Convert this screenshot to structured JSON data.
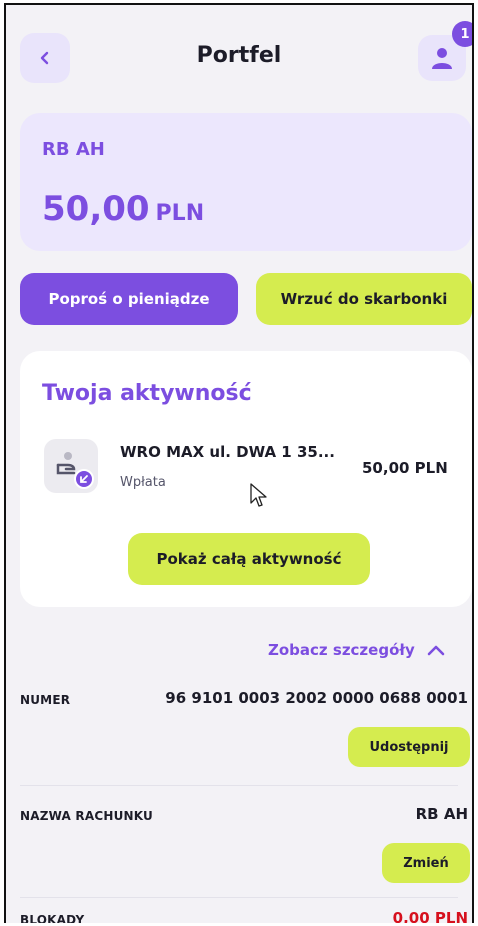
{
  "header": {
    "title": "Portfel",
    "notification_count": "1"
  },
  "account": {
    "name": "RB AH",
    "balance": "50,00",
    "currency": "PLN"
  },
  "actions": {
    "request_money": "Poproś o pieniądze",
    "deposit_piggy": "Wrzuć do skarbonki"
  },
  "activity": {
    "title": "Twoja aktywność",
    "items": [
      {
        "description": "WRO MAX ul. DWA 1 35...",
        "type": "Wpłata",
        "amount": "50,00 PLN"
      }
    ],
    "show_all": "Pokaż całą aktywność"
  },
  "details": {
    "toggle_label": "Zobacz szczegóły",
    "number_label": "NUMER",
    "number_value": "96 9101 0003 2002 0000 0688 0001",
    "share_button": "Udostępnij",
    "account_name_label": "NAZWA RACHUNKU",
    "account_name_value": "RB AH",
    "change_button": "Zmień",
    "blocks_label": "BLOKADY",
    "blocks_value": "0,00 PLN"
  },
  "colors": {
    "accent": "#7c4ee0",
    "lime": "#d5ec4f",
    "card_bg": "#ece7fd",
    "negative": "#d6101d"
  }
}
